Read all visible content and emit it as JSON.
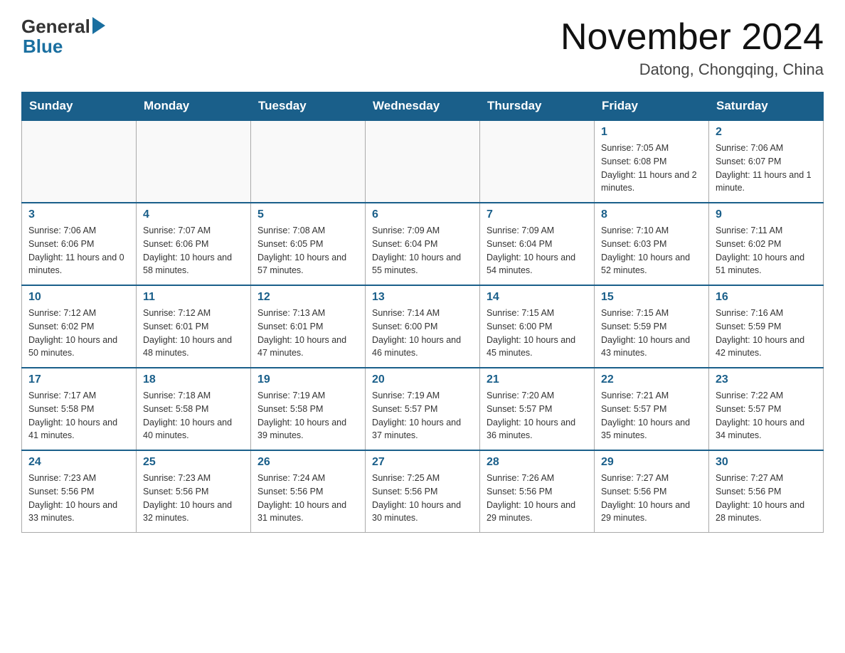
{
  "logo": {
    "general": "General",
    "blue": "Blue"
  },
  "header": {
    "month_year": "November 2024",
    "location": "Datong, Chongqing, China"
  },
  "days_of_week": [
    "Sunday",
    "Monday",
    "Tuesday",
    "Wednesday",
    "Thursday",
    "Friday",
    "Saturday"
  ],
  "weeks": [
    [
      {
        "day": "",
        "info": ""
      },
      {
        "day": "",
        "info": ""
      },
      {
        "day": "",
        "info": ""
      },
      {
        "day": "",
        "info": ""
      },
      {
        "day": "",
        "info": ""
      },
      {
        "day": "1",
        "info": "Sunrise: 7:05 AM\nSunset: 6:08 PM\nDaylight: 11 hours and 2 minutes."
      },
      {
        "day": "2",
        "info": "Sunrise: 7:06 AM\nSunset: 6:07 PM\nDaylight: 11 hours and 1 minute."
      }
    ],
    [
      {
        "day": "3",
        "info": "Sunrise: 7:06 AM\nSunset: 6:06 PM\nDaylight: 11 hours and 0 minutes."
      },
      {
        "day": "4",
        "info": "Sunrise: 7:07 AM\nSunset: 6:06 PM\nDaylight: 10 hours and 58 minutes."
      },
      {
        "day": "5",
        "info": "Sunrise: 7:08 AM\nSunset: 6:05 PM\nDaylight: 10 hours and 57 minutes."
      },
      {
        "day": "6",
        "info": "Sunrise: 7:09 AM\nSunset: 6:04 PM\nDaylight: 10 hours and 55 minutes."
      },
      {
        "day": "7",
        "info": "Sunrise: 7:09 AM\nSunset: 6:04 PM\nDaylight: 10 hours and 54 minutes."
      },
      {
        "day": "8",
        "info": "Sunrise: 7:10 AM\nSunset: 6:03 PM\nDaylight: 10 hours and 52 minutes."
      },
      {
        "day": "9",
        "info": "Sunrise: 7:11 AM\nSunset: 6:02 PM\nDaylight: 10 hours and 51 minutes."
      }
    ],
    [
      {
        "day": "10",
        "info": "Sunrise: 7:12 AM\nSunset: 6:02 PM\nDaylight: 10 hours and 50 minutes."
      },
      {
        "day": "11",
        "info": "Sunrise: 7:12 AM\nSunset: 6:01 PM\nDaylight: 10 hours and 48 minutes."
      },
      {
        "day": "12",
        "info": "Sunrise: 7:13 AM\nSunset: 6:01 PM\nDaylight: 10 hours and 47 minutes."
      },
      {
        "day": "13",
        "info": "Sunrise: 7:14 AM\nSunset: 6:00 PM\nDaylight: 10 hours and 46 minutes."
      },
      {
        "day": "14",
        "info": "Sunrise: 7:15 AM\nSunset: 6:00 PM\nDaylight: 10 hours and 45 minutes."
      },
      {
        "day": "15",
        "info": "Sunrise: 7:15 AM\nSunset: 5:59 PM\nDaylight: 10 hours and 43 minutes."
      },
      {
        "day": "16",
        "info": "Sunrise: 7:16 AM\nSunset: 5:59 PM\nDaylight: 10 hours and 42 minutes."
      }
    ],
    [
      {
        "day": "17",
        "info": "Sunrise: 7:17 AM\nSunset: 5:58 PM\nDaylight: 10 hours and 41 minutes."
      },
      {
        "day": "18",
        "info": "Sunrise: 7:18 AM\nSunset: 5:58 PM\nDaylight: 10 hours and 40 minutes."
      },
      {
        "day": "19",
        "info": "Sunrise: 7:19 AM\nSunset: 5:58 PM\nDaylight: 10 hours and 39 minutes."
      },
      {
        "day": "20",
        "info": "Sunrise: 7:19 AM\nSunset: 5:57 PM\nDaylight: 10 hours and 37 minutes."
      },
      {
        "day": "21",
        "info": "Sunrise: 7:20 AM\nSunset: 5:57 PM\nDaylight: 10 hours and 36 minutes."
      },
      {
        "day": "22",
        "info": "Sunrise: 7:21 AM\nSunset: 5:57 PM\nDaylight: 10 hours and 35 minutes."
      },
      {
        "day": "23",
        "info": "Sunrise: 7:22 AM\nSunset: 5:57 PM\nDaylight: 10 hours and 34 minutes."
      }
    ],
    [
      {
        "day": "24",
        "info": "Sunrise: 7:23 AM\nSunset: 5:56 PM\nDaylight: 10 hours and 33 minutes."
      },
      {
        "day": "25",
        "info": "Sunrise: 7:23 AM\nSunset: 5:56 PM\nDaylight: 10 hours and 32 minutes."
      },
      {
        "day": "26",
        "info": "Sunrise: 7:24 AM\nSunset: 5:56 PM\nDaylight: 10 hours and 31 minutes."
      },
      {
        "day": "27",
        "info": "Sunrise: 7:25 AM\nSunset: 5:56 PM\nDaylight: 10 hours and 30 minutes."
      },
      {
        "day": "28",
        "info": "Sunrise: 7:26 AM\nSunset: 5:56 PM\nDaylight: 10 hours and 29 minutes."
      },
      {
        "day": "29",
        "info": "Sunrise: 7:27 AM\nSunset: 5:56 PM\nDaylight: 10 hours and 29 minutes."
      },
      {
        "day": "30",
        "info": "Sunrise: 7:27 AM\nSunset: 5:56 PM\nDaylight: 10 hours and 28 minutes."
      }
    ]
  ]
}
